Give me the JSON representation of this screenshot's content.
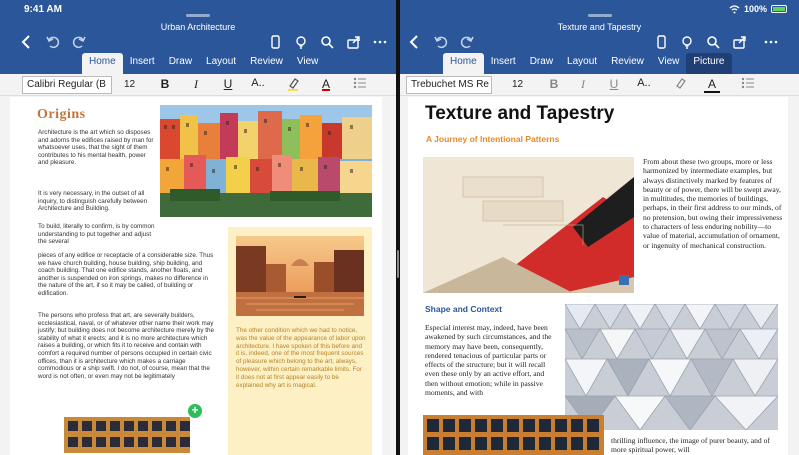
{
  "status": {
    "time": "9:41 AM",
    "battery": "100%"
  },
  "left": {
    "doc_title": "Urban Architecture",
    "tabs": [
      "Home",
      "Insert",
      "Draw",
      "Layout",
      "Review",
      "View"
    ],
    "font_name": "Calibri Regular (B",
    "font_size": "12",
    "heading": "Origins",
    "p1": "Architecture is the art which so disposes and adorns the edifices raised by man for whatsoever uses, that the sight of them contributes to his mental health, power and pleasure.",
    "p2": "It is very necessary, in the outset of all inquiry, to distinguish carefully between Architecture and Building.",
    "p3a": "To build, literally to confirm, is by common understanding to put together and adjust the several",
    "p3b": "pieces of any edifice or receptacle of a considerable size. Thus we have church building, house building, ship building, and coach building. That one edifice stands, another floats, and another is suspended on iron springs, makes no difference in the nature of the art, if so it may be called, of building or edification.",
    "p4": "The persons who profess that art, are severally builders, ecclesiastical, naval, or of whatever other name their work may justify; but building does not become architecture merely by the stability of what it erects; and it is no more architecture which raises a building, or which fits it to receive and contain with comfort a required number of persons occupied in certain civic offices, than it is architecture which makes a carriage commodious or a ship swift. I do not, of course, mean that the word is not often, or even may not be legitimately",
    "yellow_text": "The other condition which we had to notice, was the value of the appearance of labor upon architecture. I have spoken of this before and it is, indeed, one of the most frequent sources of pleasure which belong to the art, always, however, within certain remarkable limits. For it does not at first appear easily to be explained why art is magical."
  },
  "right": {
    "doc_title": "Texture and Tapestry",
    "tabs": [
      "Home",
      "Insert",
      "Draw",
      "Layout",
      "Review",
      "View",
      "Picture"
    ],
    "font_name": "Trebuchet MS Re",
    "font_size": "12",
    "title": "Texture and Tapestry",
    "subtitle": "A Journey of Intentional Patterns",
    "p1": "From about these two groups, more or less harmonized by intermediate examples, but always distinctively marked by features of beauty or of power, there will be swept away, in multitudes, the memories of buildings, perhaps, in their first address to our minds, of no pretension, but owing their impressiveness to characters of less enduring nobility—to value of material, accumulation of ornament, or ingenuity of mechanical construction.",
    "section": "Shape and Context",
    "p2": "Especial interest may, indeed, have been awakened by such circumstances, and the memory may have been, consequently, rendered tenacious of particular parts or effects of the structure; but it will recall even these only by an active effort, and then without emotion; while in passive moments, and with",
    "p3": "thrilling influence, the image of purer beauty, and of more spiritual power, will"
  }
}
